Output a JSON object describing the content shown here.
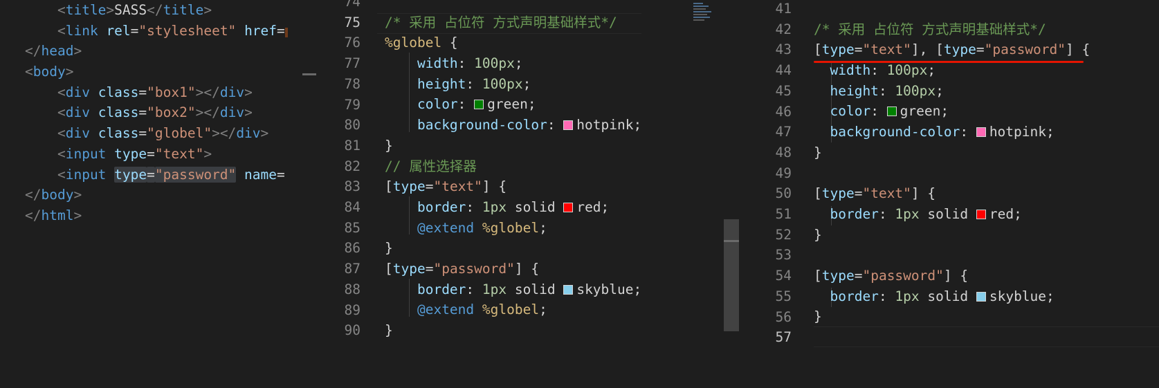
{
  "html_pane": {
    "lines": [
      {
        "indent": "    ",
        "parts": [
          [
            "br",
            "<"
          ],
          [
            "tag",
            "title"
          ],
          [
            "br",
            ">"
          ],
          [
            "txt",
            "SASS"
          ],
          [
            "br",
            "</"
          ],
          [
            "tag",
            "title"
          ],
          [
            "br",
            ">"
          ]
        ]
      },
      {
        "indent": "    ",
        "parts": [
          [
            "br",
            "<"
          ],
          [
            "tag",
            "link"
          ],
          [
            "txt",
            " "
          ],
          [
            "attr",
            "rel"
          ],
          [
            "txt",
            "="
          ],
          [
            "str",
            "\"stylesheet\""
          ],
          [
            "txt",
            " "
          ],
          [
            "attr",
            "href"
          ],
          [
            "txt",
            "="
          ]
        ]
      },
      {
        "indent": "",
        "parts": [
          [
            "br",
            "</"
          ],
          [
            "tag",
            "head"
          ],
          [
            "br",
            ">"
          ]
        ]
      },
      {
        "indent": "",
        "parts": [
          [
            "br",
            "<"
          ],
          [
            "tag",
            "body"
          ],
          [
            "br",
            ">"
          ]
        ]
      },
      {
        "indent": "    ",
        "parts": [
          [
            "br",
            "<"
          ],
          [
            "tag",
            "div"
          ],
          [
            "txt",
            " "
          ],
          [
            "attr",
            "class"
          ],
          [
            "txt",
            "="
          ],
          [
            "str",
            "\"box1\""
          ],
          [
            "br",
            "></"
          ],
          [
            "tag",
            "div"
          ],
          [
            "br",
            ">"
          ]
        ]
      },
      {
        "indent": "    ",
        "parts": [
          [
            "br",
            "<"
          ],
          [
            "tag",
            "div"
          ],
          [
            "txt",
            " "
          ],
          [
            "attr",
            "class"
          ],
          [
            "txt",
            "="
          ],
          [
            "str",
            "\"box2\""
          ],
          [
            "br",
            "></"
          ],
          [
            "tag",
            "div"
          ],
          [
            "br",
            ">"
          ]
        ]
      },
      {
        "indent": "    ",
        "parts": [
          [
            "br",
            "<"
          ],
          [
            "tag",
            "div"
          ],
          [
            "txt",
            " "
          ],
          [
            "attr",
            "class"
          ],
          [
            "txt",
            "="
          ],
          [
            "str",
            "\"globel\""
          ],
          [
            "br",
            "></"
          ],
          [
            "tag",
            "div"
          ],
          [
            "br",
            ">"
          ]
        ]
      },
      {
        "indent": "    ",
        "parts": [
          [
            "br",
            "<"
          ],
          [
            "tag",
            "input"
          ],
          [
            "txt",
            " "
          ],
          [
            "attr",
            "type"
          ],
          [
            "txt",
            "="
          ],
          [
            "str",
            "\"text\""
          ],
          [
            "br",
            ">"
          ]
        ]
      },
      {
        "indent": "    ",
        "parts": [
          [
            "br",
            "<"
          ],
          [
            "tag",
            "input"
          ],
          [
            "txt",
            " "
          ],
          [
            "attr",
            "type",
            "sel"
          ],
          [
            "txt",
            "=",
            "sel"
          ],
          [
            "str",
            "\"password\"",
            "sel"
          ],
          [
            "txt",
            " "
          ],
          [
            "attr",
            "name"
          ],
          [
            "txt",
            "="
          ]
        ]
      },
      {
        "indent": "",
        "parts": [
          [
            "br",
            "</"
          ],
          [
            "tag",
            "body"
          ],
          [
            "br",
            ">"
          ]
        ]
      },
      {
        "indent": "",
        "parts": [
          [
            "br",
            "</"
          ],
          [
            "tag",
            "html"
          ],
          [
            "br",
            ">"
          ]
        ]
      }
    ]
  },
  "scss_pane": {
    "line_numbers": [
      "74",
      "75",
      "76",
      "77",
      "78",
      "79",
      "80",
      "81",
      "82",
      "83",
      "84",
      "85",
      "86",
      "87",
      "88",
      "89",
      "90"
    ],
    "current_line": "75",
    "lines": [
      {
        "indent": "",
        "parts": []
      },
      {
        "indent": "",
        "parts": [
          [
            "com",
            "/* 采用 占位符 方式声明基础样式*/"
          ]
        ]
      },
      {
        "indent": "",
        "parts": [
          [
            "sel",
            "%globel"
          ],
          [
            "txt",
            " {"
          ]
        ]
      },
      {
        "indent": "    ",
        "parts": [
          [
            "attr",
            "width"
          ],
          [
            "txt",
            ": "
          ],
          [
            "num",
            "100px"
          ],
          [
            "txt",
            ";"
          ]
        ]
      },
      {
        "indent": "    ",
        "parts": [
          [
            "attr",
            "height"
          ],
          [
            "txt",
            ": "
          ],
          [
            "num",
            "100px"
          ],
          [
            "txt",
            ";"
          ]
        ]
      },
      {
        "indent": "    ",
        "parts": [
          [
            "attr",
            "color"
          ],
          [
            "txt",
            ": "
          ],
          [
            "swatch",
            "#008000"
          ],
          [
            "txt",
            "green;"
          ]
        ]
      },
      {
        "indent": "    ",
        "parts": [
          [
            "attr",
            "background-color"
          ],
          [
            "txt",
            ": "
          ],
          [
            "swatch",
            "#ff69b4"
          ],
          [
            "txt",
            "hotpink;"
          ]
        ]
      },
      {
        "indent": "",
        "parts": [
          [
            "txt",
            "}"
          ]
        ]
      },
      {
        "indent": "",
        "parts": [
          [
            "com",
            "// 属性选择器"
          ]
        ]
      },
      {
        "indent": "",
        "parts": [
          [
            "txt",
            "["
          ],
          [
            "attr",
            "type"
          ],
          [
            "txt",
            "="
          ],
          [
            "str",
            "\"text\""
          ],
          [
            "txt",
            "] {"
          ]
        ]
      },
      {
        "indent": "    ",
        "parts": [
          [
            "attr",
            "border"
          ],
          [
            "txt",
            ": "
          ],
          [
            "num",
            "1px"
          ],
          [
            "txt",
            " solid "
          ],
          [
            "swatch",
            "#ff0000"
          ],
          [
            "txt",
            "red;"
          ]
        ]
      },
      {
        "indent": "    ",
        "parts": [
          [
            "at",
            "@extend"
          ],
          [
            "txt",
            " "
          ],
          [
            "sel",
            "%globel"
          ],
          [
            "txt",
            ";"
          ]
        ]
      },
      {
        "indent": "",
        "parts": [
          [
            "txt",
            "}"
          ]
        ]
      },
      {
        "indent": "",
        "parts": [
          [
            "txt",
            "["
          ],
          [
            "attr",
            "type"
          ],
          [
            "txt",
            "="
          ],
          [
            "str",
            "\"password\""
          ],
          [
            "txt",
            "] {"
          ]
        ]
      },
      {
        "indent": "    ",
        "parts": [
          [
            "attr",
            "border"
          ],
          [
            "txt",
            ": "
          ],
          [
            "num",
            "1px"
          ],
          [
            "txt",
            " solid "
          ],
          [
            "swatch",
            "#87ceeb"
          ],
          [
            "txt",
            "skyblue;"
          ]
        ]
      },
      {
        "indent": "    ",
        "parts": [
          [
            "at",
            "@extend"
          ],
          [
            "txt",
            " "
          ],
          [
            "sel",
            "%globel"
          ],
          [
            "txt",
            ";"
          ]
        ]
      },
      {
        "indent": "",
        "parts": [
          [
            "txt",
            "}"
          ]
        ]
      }
    ]
  },
  "css_pane": {
    "line_numbers": [
      "41",
      "42",
      "43",
      "44",
      "45",
      "46",
      "47",
      "48",
      "49",
      "50",
      "51",
      "52",
      "53",
      "54",
      "55",
      "56",
      "57"
    ],
    "current_line": "57",
    "lines": [
      {
        "indent": "",
        "parts": []
      },
      {
        "indent": "",
        "parts": [
          [
            "com",
            "/* 采用 占位符 方式声明基础样式*/"
          ]
        ]
      },
      {
        "indent": "",
        "parts": [
          [
            "txt",
            "["
          ],
          [
            "attr",
            "type"
          ],
          [
            "txt",
            "="
          ],
          [
            "str",
            "\"text\""
          ],
          [
            "txt",
            "], ["
          ],
          [
            "attr",
            "type"
          ],
          [
            "txt",
            "="
          ],
          [
            "str",
            "\"password\""
          ],
          [
            "txt",
            "] {"
          ]
        ]
      },
      {
        "indent": "  ",
        "parts": [
          [
            "attr",
            "width"
          ],
          [
            "txt",
            ": "
          ],
          [
            "num",
            "100px"
          ],
          [
            "txt",
            ";"
          ]
        ]
      },
      {
        "indent": "  ",
        "parts": [
          [
            "attr",
            "height"
          ],
          [
            "txt",
            ": "
          ],
          [
            "num",
            "100px"
          ],
          [
            "txt",
            ";"
          ]
        ]
      },
      {
        "indent": "  ",
        "parts": [
          [
            "attr",
            "color"
          ],
          [
            "txt",
            ": "
          ],
          [
            "swatch",
            "#008000"
          ],
          [
            "txt",
            "green;"
          ]
        ]
      },
      {
        "indent": "  ",
        "parts": [
          [
            "attr",
            "background-color"
          ],
          [
            "txt",
            ": "
          ],
          [
            "swatch",
            "#ff69b4"
          ],
          [
            "txt",
            "hotpink;"
          ]
        ]
      },
      {
        "indent": "",
        "parts": [
          [
            "txt",
            "}"
          ]
        ]
      },
      {
        "indent": "",
        "parts": []
      },
      {
        "indent": "",
        "parts": [
          [
            "txt",
            "["
          ],
          [
            "attr",
            "type"
          ],
          [
            "txt",
            "="
          ],
          [
            "str",
            "\"text\""
          ],
          [
            "txt",
            "] {"
          ]
        ]
      },
      {
        "indent": "  ",
        "parts": [
          [
            "attr",
            "border"
          ],
          [
            "txt",
            ": "
          ],
          [
            "num",
            "1px"
          ],
          [
            "txt",
            " solid "
          ],
          [
            "swatch",
            "#ff0000"
          ],
          [
            "txt",
            "red;"
          ]
        ]
      },
      {
        "indent": "",
        "parts": [
          [
            "txt",
            "}"
          ]
        ]
      },
      {
        "indent": "",
        "parts": []
      },
      {
        "indent": "",
        "parts": [
          [
            "txt",
            "["
          ],
          [
            "attr",
            "type"
          ],
          [
            "txt",
            "="
          ],
          [
            "str",
            "\"password\""
          ],
          [
            "txt",
            "] {"
          ]
        ]
      },
      {
        "indent": "  ",
        "parts": [
          [
            "attr",
            "border"
          ],
          [
            "txt",
            ": "
          ],
          [
            "num",
            "1px"
          ],
          [
            "txt",
            " solid "
          ],
          [
            "swatch",
            "#87ceeb"
          ],
          [
            "txt",
            "skyblue;"
          ]
        ]
      },
      {
        "indent": "",
        "parts": [
          [
            "txt",
            "}"
          ]
        ]
      },
      {
        "indent": "",
        "parts": []
      }
    ]
  },
  "colors": {
    "editor_bg": "#1e1e1e",
    "line_number": "#858585",
    "comment": "#6a9955",
    "string": "#ce9178",
    "selector": "#d7ba7d",
    "property": "#9cdcfe",
    "number": "#b5cea8",
    "annotation_underline": "#e51400"
  }
}
